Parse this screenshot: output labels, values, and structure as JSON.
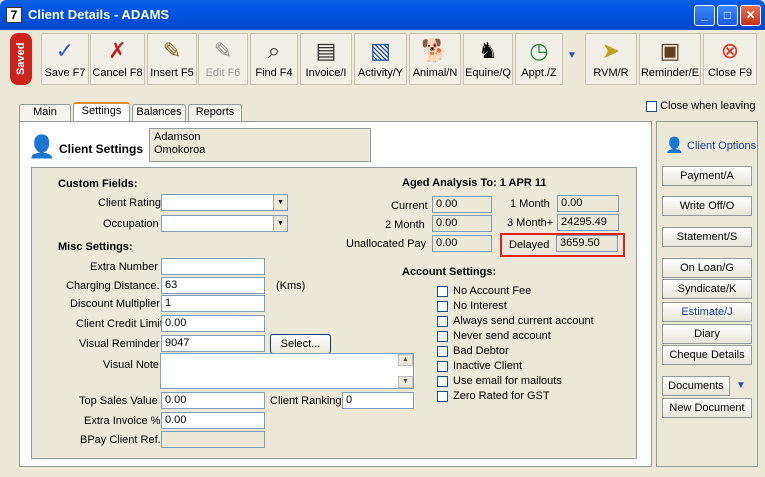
{
  "window": {
    "title": "Client Details - ADAMS",
    "app_icon": "7"
  },
  "toolbar": {
    "saved": "Saved",
    "buttons": [
      {
        "label": "Save F7",
        "icon": "✓"
      },
      {
        "label": "Cancel F8",
        "icon": "✗"
      },
      {
        "label": "Insert F5",
        "icon": "✎"
      },
      {
        "label": "Edit F6",
        "icon": "✎"
      },
      {
        "label": "Find F4",
        "icon": "⌕"
      },
      {
        "label": "Invoice/I",
        "icon": "▤"
      },
      {
        "label": "Activity/Y",
        "icon": "▧"
      },
      {
        "label": "Animal/N",
        "icon": "🐕"
      },
      {
        "label": "Equine/Q",
        "icon": "♞"
      },
      {
        "label": "Appt./Z",
        "icon": "◷"
      },
      {
        "label": "RVM/R",
        "icon": "➤"
      },
      {
        "label": "Reminder/E",
        "icon": "▣"
      },
      {
        "label": "Close F9",
        "icon": "⊗"
      }
    ]
  },
  "tabs": [
    "Main",
    "Settings",
    "Balances",
    "Reports"
  ],
  "close_when_leaving": "Close when leaving",
  "client": {
    "heading": "Client Settings",
    "name": "Adamson",
    "location": "Omokoroa"
  },
  "custom_fields": {
    "heading": "Custom Fields:",
    "client_rating_label": "Client Rating",
    "client_rating_value": "",
    "occupation_label": "Occupation",
    "occupation_value": ""
  },
  "misc": {
    "heading": "Misc Settings:",
    "extra_number_label": "Extra Number",
    "extra_number": "",
    "charging_distance_label": "Charging Distance.",
    "charging_distance": "63",
    "kms": "(Kms)",
    "discount_multiplier_label": "Discount Multiplier",
    "discount_multiplier": "1",
    "credit_limit_label": "Client Credit Limit",
    "credit_limit": "0.00",
    "visual_reminder_label": "Visual Reminder",
    "visual_reminder": "9047",
    "select_btn": "Select...",
    "visual_note_label": "Visual Note",
    "visual_note": "",
    "top_sales_label": "Top Sales Value",
    "top_sales": "0.00",
    "client_ranking_label": "Client Ranking",
    "client_ranking": "0",
    "extra_invoice_label": "Extra Invoice %",
    "extra_invoice": "0.00",
    "bpay_label": "BPay Client Ref.",
    "bpay": ""
  },
  "aged": {
    "heading": "Aged Analysis To: 1 APR 11",
    "current_label": "Current",
    "current": "0.00",
    "month1_label": "1 Month",
    "month1": "0.00",
    "month2_label": "2 Month",
    "month2": "0.00",
    "month3_label": "3 Month+",
    "month3": "24295.49",
    "unalloc_label": "Unallocated Pay",
    "unalloc": "0.00",
    "delayed_label": "Delayed",
    "delayed": "3659.50"
  },
  "account": {
    "heading": "Account Settings:",
    "options": [
      "No Account Fee",
      "No Interest",
      "Always send current account",
      "Never send account",
      "Bad Debtor",
      "Inactive Client",
      "Use email for mailouts",
      "Zero Rated for GST"
    ]
  },
  "right": {
    "title": "Client Options",
    "buttons": [
      "Payment/A",
      "Write Off/O",
      "Statement/S",
      "On Loan/G",
      "Syndicate/K",
      "Estimate/J",
      "Diary",
      "Cheque Details",
      "Documents",
      "New Document"
    ]
  }
}
